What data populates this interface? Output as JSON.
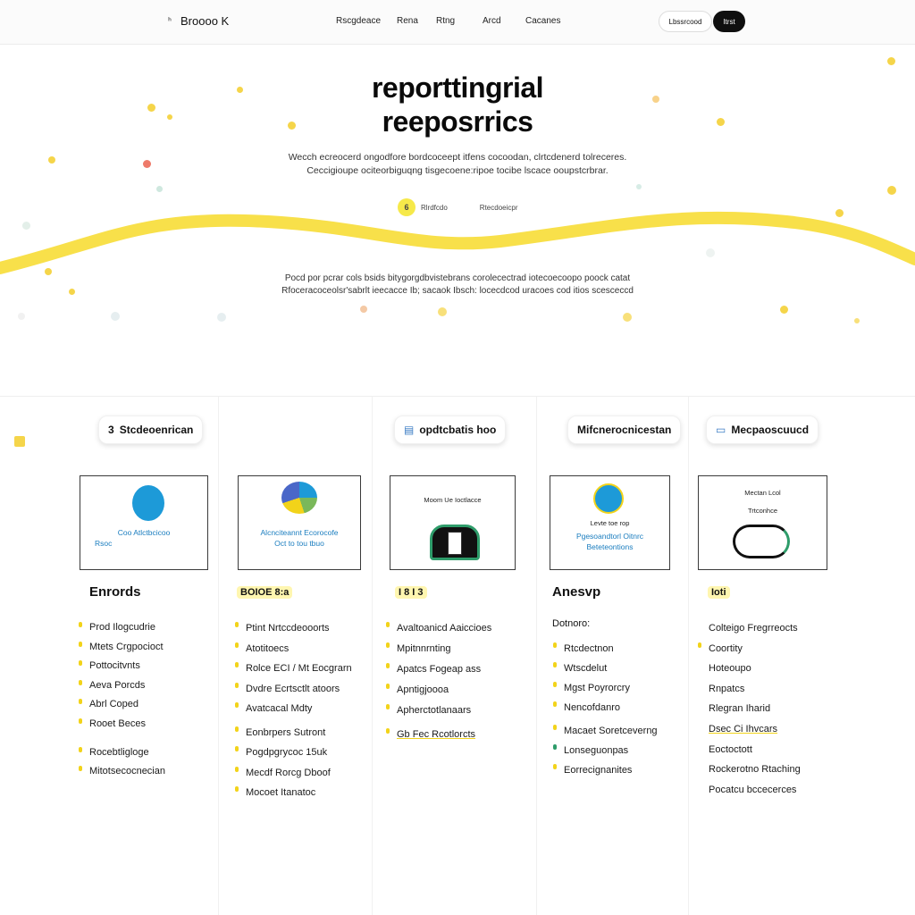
{
  "header": {
    "brand": "Broooo K",
    "nav": [
      "Rscgdeace",
      "Rena",
      "Rtng",
      "Arcd",
      "Cacanes"
    ],
    "secondary_button": "Lbssrcood",
    "primary_button": "Itrst"
  },
  "hero": {
    "title_line1": "reporttingrial",
    "title_line2": "reeposrrics",
    "subtitle_line1": "Wecch ecreocerd ongodfore bordcoceept itfens cocoodan, clrtcdenerd tolreceres.",
    "subtitle_line2": "Ceccigioupe ociteorbiguqng tisgecoene:ripoe tocibe lscace ooupstcrbrar.",
    "pill_icon": "6",
    "pill_label": "Rlrdfcdo",
    "pill_secondary": "Rtecdoeicpr",
    "lower_line1": "Pocd por pcrar cols bsids bitygorgdbvistebrans corolecectrad iotecoecoopo poock catat",
    "lower_line2": "Rfoceracoceolsr'sabrlt ieecacce Ib; sacaok Ibsch: locecdcod uracoes cod itios scesceccd",
    "accent_color": "#f8e04a"
  },
  "columns": [
    {
      "badge": "Stcdeoenrican",
      "badge_icon": "3",
      "card_lines": [
        "Coo Atlctbcicoo",
        "Rsoc"
      ],
      "heading": "Enrords",
      "items": [
        "Prod Ilogcudrie",
        "Mtets Crgpocioct",
        "Pottocitvnts",
        "Aeva Porcds",
        "Abrl Coped",
        "Rooet Beces",
        "Rocebtligloge",
        "Mitotsecocnecian"
      ]
    },
    {
      "badge": "",
      "badge_icon": "",
      "card_lines": [
        "Alcnciteannt Ecorocofe",
        "Oct to tou tbuo"
      ],
      "heading": "BOIOE 8:a",
      "items": [
        "Ptint Nrtccdeooorts",
        "Atotitoecs",
        "Rolce ECI / Mt Eocgrarn",
        "Dvdre Ecrtsctlt atoors",
        "Avatcacal Mdty",
        "Eonbrpers Sutront",
        "Pogdpgrycoc 15uk",
        "Mecdf Rorcg Dboof",
        "Mocoet Itanatoc"
      ]
    },
    {
      "badge": "opdtcbatis hoo",
      "badge_icon": "▤",
      "card_lines": [
        "Moom Ue Ioctlacce"
      ],
      "heading": "I 8 I 3",
      "items": [
        "Avaltoanicd Aaiccioes",
        "Mpitnnrnting",
        "Apatcs Fogeap ass",
        "Apntigjoooa",
        "Apherctotlanaars",
        "Gb Fec Rcotlorcts"
      ]
    },
    {
      "badge": "Mifcnerocnicestan",
      "badge_icon": "",
      "card_lines": [
        "Pgesoandtorl Oitnrc",
        "Beteteontions"
      ],
      "card_small": "Levte toe rop",
      "heading": "Anesvp",
      "sub_heading": "Dotnoro:",
      "items": [
        "Rtcdectnon",
        "Wtscdelut",
        "Mgst Poyrorcry",
        "Nencofdanro",
        "Macaet Soretceverng",
        "Lonseguonpas",
        "Eorrecignanites"
      ]
    },
    {
      "badge": "Mecpaoscuucd",
      "badge_icon": "▭",
      "card_lines": [
        "Trtconhce"
      ],
      "card_top": "Mectan Lcol",
      "heading": "Ioti",
      "items": [
        "Colteigo Fregrreocts",
        "Coortity",
        "Hoteoupo",
        "Rnpatcs",
        "Rlegran Iharid",
        "Dsec Ci Ihvcars",
        "Eoctoctott",
        "Rockerotno Rtaching",
        "Pocatcu bccecerces"
      ]
    }
  ]
}
